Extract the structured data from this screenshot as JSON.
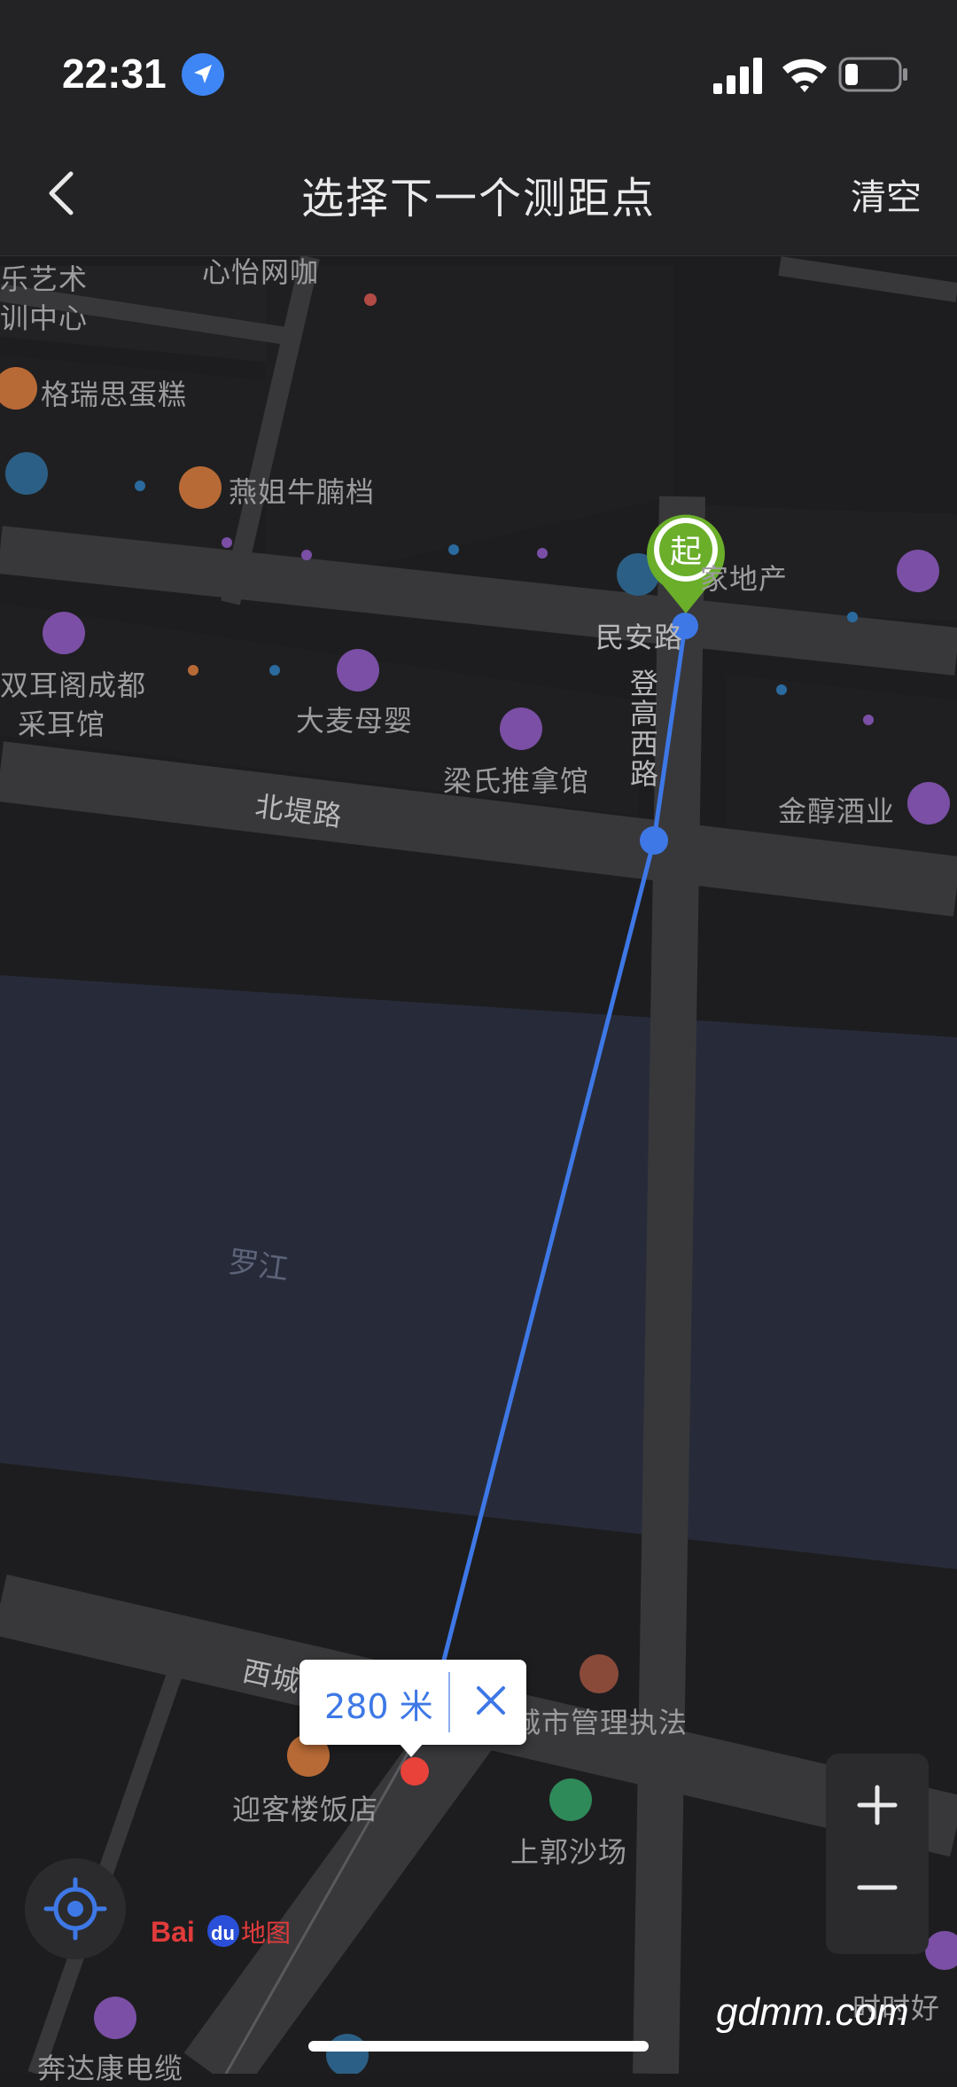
{
  "status_bar": {
    "time": "22:31"
  },
  "nav": {
    "title": "选择下一个测距点",
    "clear_label": "清空"
  },
  "map": {
    "start_marker": "起",
    "pois": [
      "乐艺术",
      "训中心",
      "心怡网咖",
      "格瑞思蛋糕",
      "燕姐牛腩档",
      "家地产",
      "民安路",
      "双耳阁成都",
      "采耳馆",
      "大麦母婴",
      "梁氏推拿馆",
      "金醇酒业",
      "北堤路",
      "罗江",
      "西城",
      "城市管理执法",
      "迎客楼饭店",
      "上郭沙场",
      "奔达康电缆",
      "时时好"
    ],
    "vertical_road": "登高西路"
  },
  "measure": {
    "distance": "280 米"
  },
  "controls": {
    "zoom_in": "+",
    "zoom_out": "−"
  },
  "brand": {
    "logo": "Bai du 地图"
  },
  "watermark": "gdmm.com",
  "icons": [
    "location-arrow-icon",
    "signal-icon",
    "wifi-icon",
    "battery-icon",
    "back-chevron-icon",
    "close-icon",
    "locate-icon"
  ],
  "colors": {
    "route": "#3e78e6",
    "start_pin": "#6aae2a",
    "end_point": "#e8423a",
    "river": "#272b39"
  }
}
